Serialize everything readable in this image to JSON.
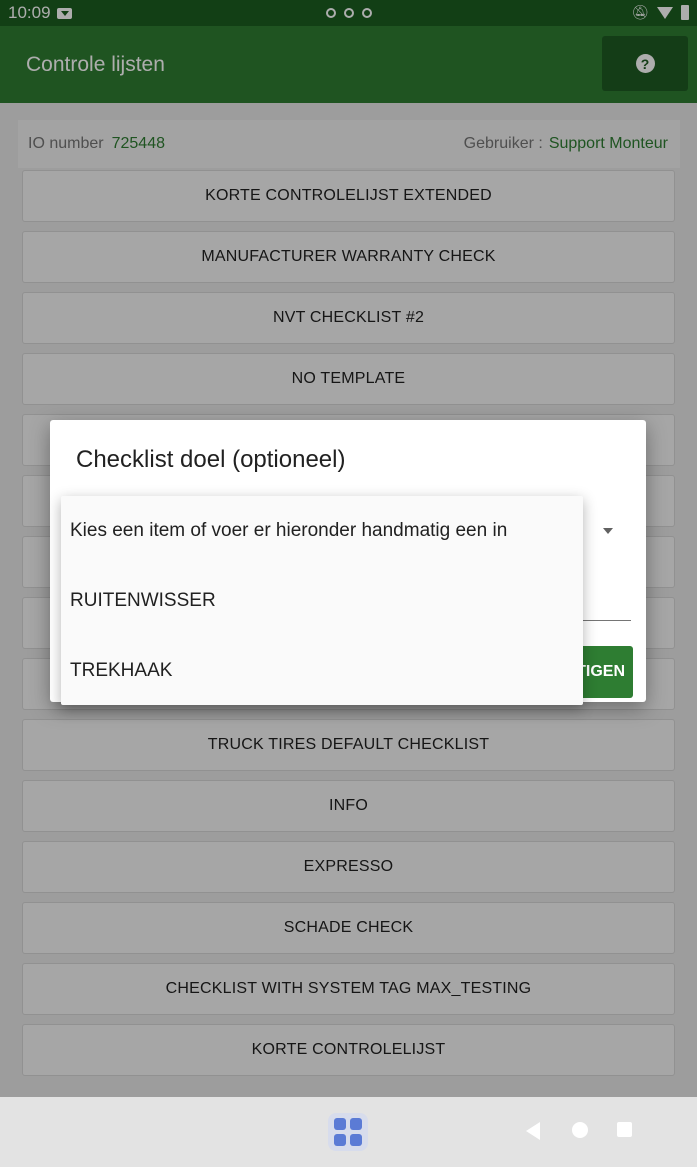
{
  "status_bar": {
    "time": "10:09"
  },
  "app_bar": {
    "title": "Controle lijsten",
    "help_glyph": "?"
  },
  "info": {
    "io_label": "IO number",
    "io_value": "725448",
    "user_label": "Gebruiker :",
    "user_value": "Support Monteur"
  },
  "checklists": [
    {
      "label": "KORTE CONTROLELIJST EXTENDED"
    },
    {
      "label": "MANUFACTURER WARRANTY CHECK"
    },
    {
      "label": "NVT CHECKLIST #2"
    },
    {
      "label": "NO TEMPLATE"
    },
    {
      "label": ""
    },
    {
      "label": ""
    },
    {
      "label": ""
    },
    {
      "label": ""
    },
    {
      "label": ""
    },
    {
      "label": "TRUCK TIRES DEFAULT CHECKLIST"
    },
    {
      "label": "INFO"
    },
    {
      "label": "EXPRESSO"
    },
    {
      "label": "SCHADE CHECK"
    },
    {
      "label": "CHECKLIST WITH SYSTEM TAG MAX_TESTING"
    },
    {
      "label": "KORTE CONTROLELIJST"
    }
  ],
  "dialog": {
    "title": "Checklist doel (optioneel)",
    "confirm_label": "TIGEN",
    "dropdown_options": [
      "Kies een item of voer er hieronder handmatig een in",
      "RUITENWISSER",
      "TREKHAAK"
    ]
  },
  "colors": {
    "primary": "#2e7d32",
    "primary_dark": "#1b5e20",
    "accent_text": "#2e7d32"
  },
  "icons": {
    "help": "help-icon",
    "dropdown": "caret-down-icon",
    "apps": "apps-grid-icon",
    "back": "back-icon",
    "home": "home-icon",
    "recents": "recents-icon"
  }
}
